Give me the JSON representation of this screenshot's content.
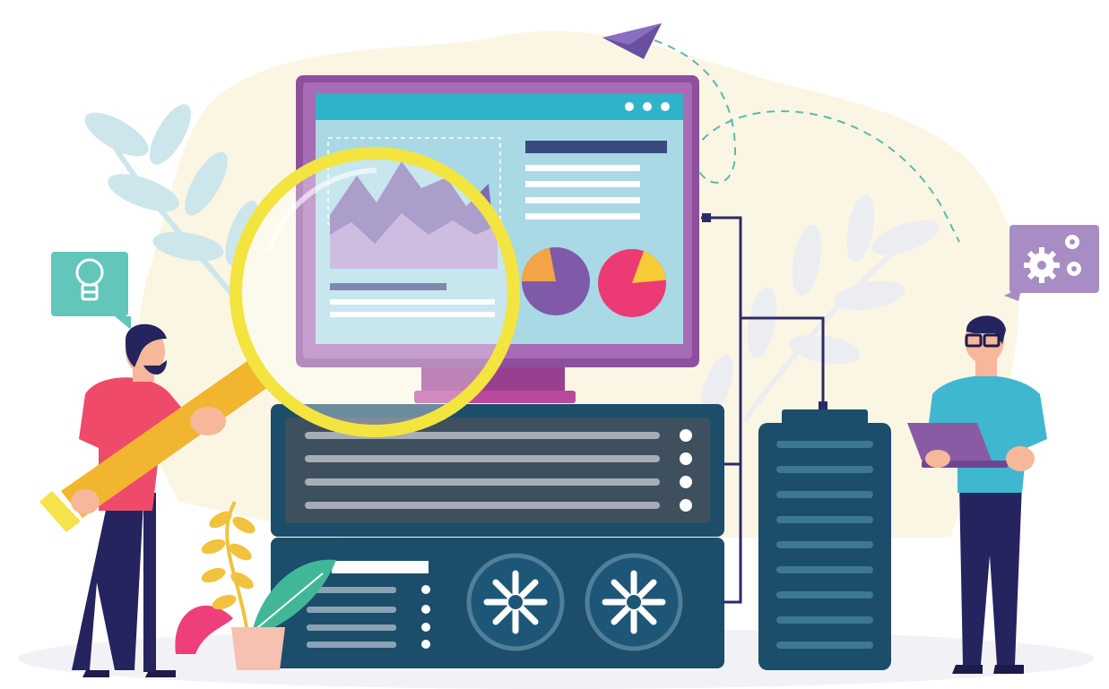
{
  "illustration": {
    "palette": {
      "background": "#ffffff",
      "blob": "#fbf6e4",
      "monitor_frame": "#8e4f9c",
      "screen": "#a9d9e5",
      "screen_header": "#2fb3c9",
      "server_dark": "#1c4d6b",
      "server_panel": "#3e4f5e",
      "magnifier_rim": "#f3e440",
      "shirt_pink": "#ef4a6a",
      "shirt_teal": "#3fb7cf",
      "pants": "#25245f",
      "leaf_light": "#cde6ec"
    },
    "icons": {
      "idea_bubble": "lightbulb-icon",
      "settings_bubble": "gears-icon",
      "paper_plane": "paper-plane-icon"
    },
    "charts": {
      "pie_left_slice_fraction": 0.22,
      "pie_right_slice_fraction": 0.18
    }
  }
}
